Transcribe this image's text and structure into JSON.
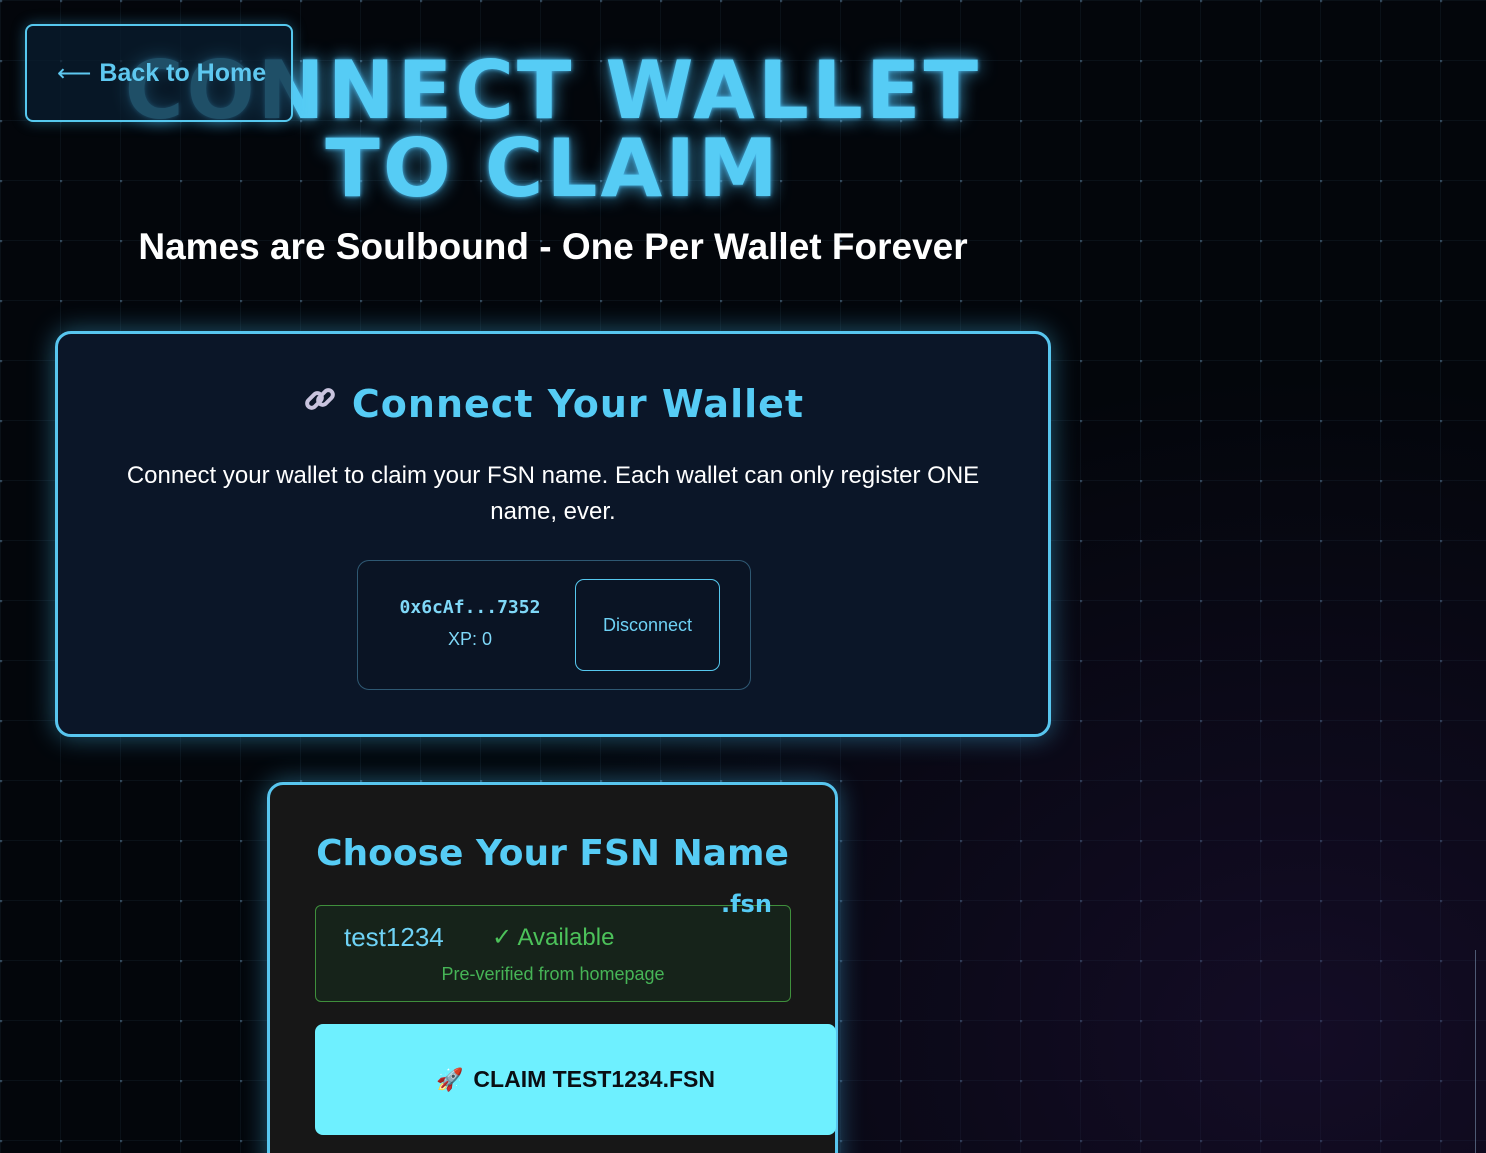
{
  "header": {
    "back_label": "Back to Home",
    "title_line1": "CONNECT WALLET",
    "title_line2": "TO CLAIM",
    "subtitle": "Names are Soulbound - One Per Wallet Forever"
  },
  "wallet_card": {
    "icon": "link-icon",
    "heading": "Connect Your Wallet",
    "description": "Connect your wallet to claim your FSN name. Each wallet can only register ONE name, ever.",
    "address": "0x6cAf...7352",
    "xp": "XP: 0",
    "disconnect_label": "Disconnect"
  },
  "name_card": {
    "heading": "Choose Your FSN Name",
    "tld": ".fsn",
    "name_value": "test1234",
    "status": "✓ Available",
    "status_note": "Pre-verified from homepage",
    "claim_icon": "rocket-icon",
    "claim_label": "CLAIM TEST1234.FSN"
  },
  "colors": {
    "accent": "#56ccf5",
    "claim_button": "#6ef0ff",
    "available_green": "#4cc25a"
  }
}
